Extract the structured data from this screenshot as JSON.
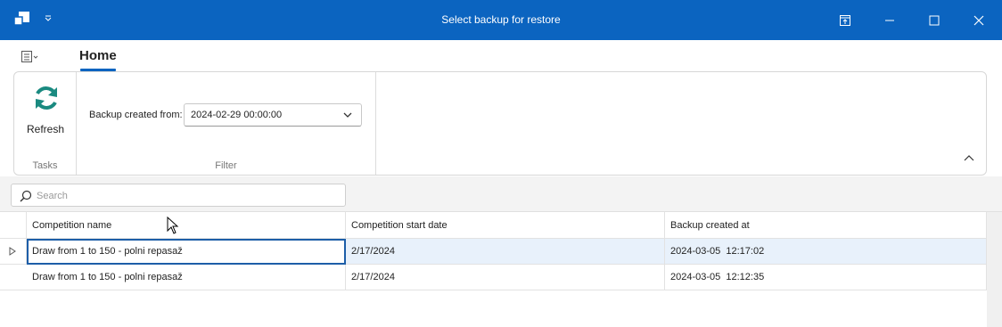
{
  "window": {
    "title": "Select backup for restore"
  },
  "tabs": {
    "home_label": "Home"
  },
  "ribbon": {
    "refresh_label": "Refresh",
    "tasks_group_label": "Tasks",
    "filter_group_label": "Filter",
    "backup_created_from_label": "Backup created from:",
    "backup_created_from_value": "2024-02-29 00:00:00"
  },
  "search": {
    "placeholder": "Search",
    "value": ""
  },
  "grid": {
    "columns": [
      "Competition name",
      "Competition start date",
      "Backup created at"
    ],
    "rows": [
      {
        "name": "Draw from 1 to 150 - polni repasaž",
        "start_date": "2/17/2024",
        "created_at": "2024-03-05  12:17:02"
      },
      {
        "name": "Draw from 1 to 150 - polni repasaž",
        "start_date": "2/17/2024",
        "created_at": "2024-03-05  12:12:35"
      }
    ]
  },
  "colors": {
    "titlebar": "#0b64c0",
    "accent": "#0b64c0",
    "refresh_icon": "#1a8a80",
    "selected_row": "#e8f1fb"
  },
  "icons": {
    "app": "app-logo-icon",
    "quick_access": "chevron-down-icon",
    "minimize": "minimize-icon",
    "maximize": "maximize-icon",
    "close": "close-icon",
    "restore_bar": "restore-window-icon",
    "menu": "ribbon-menu-icon",
    "refresh": "refresh-icon",
    "dropdown": "chevron-down-icon",
    "collapse": "chevron-up-icon",
    "search": "search-icon",
    "row_indicator": "row-indicator-icon"
  }
}
